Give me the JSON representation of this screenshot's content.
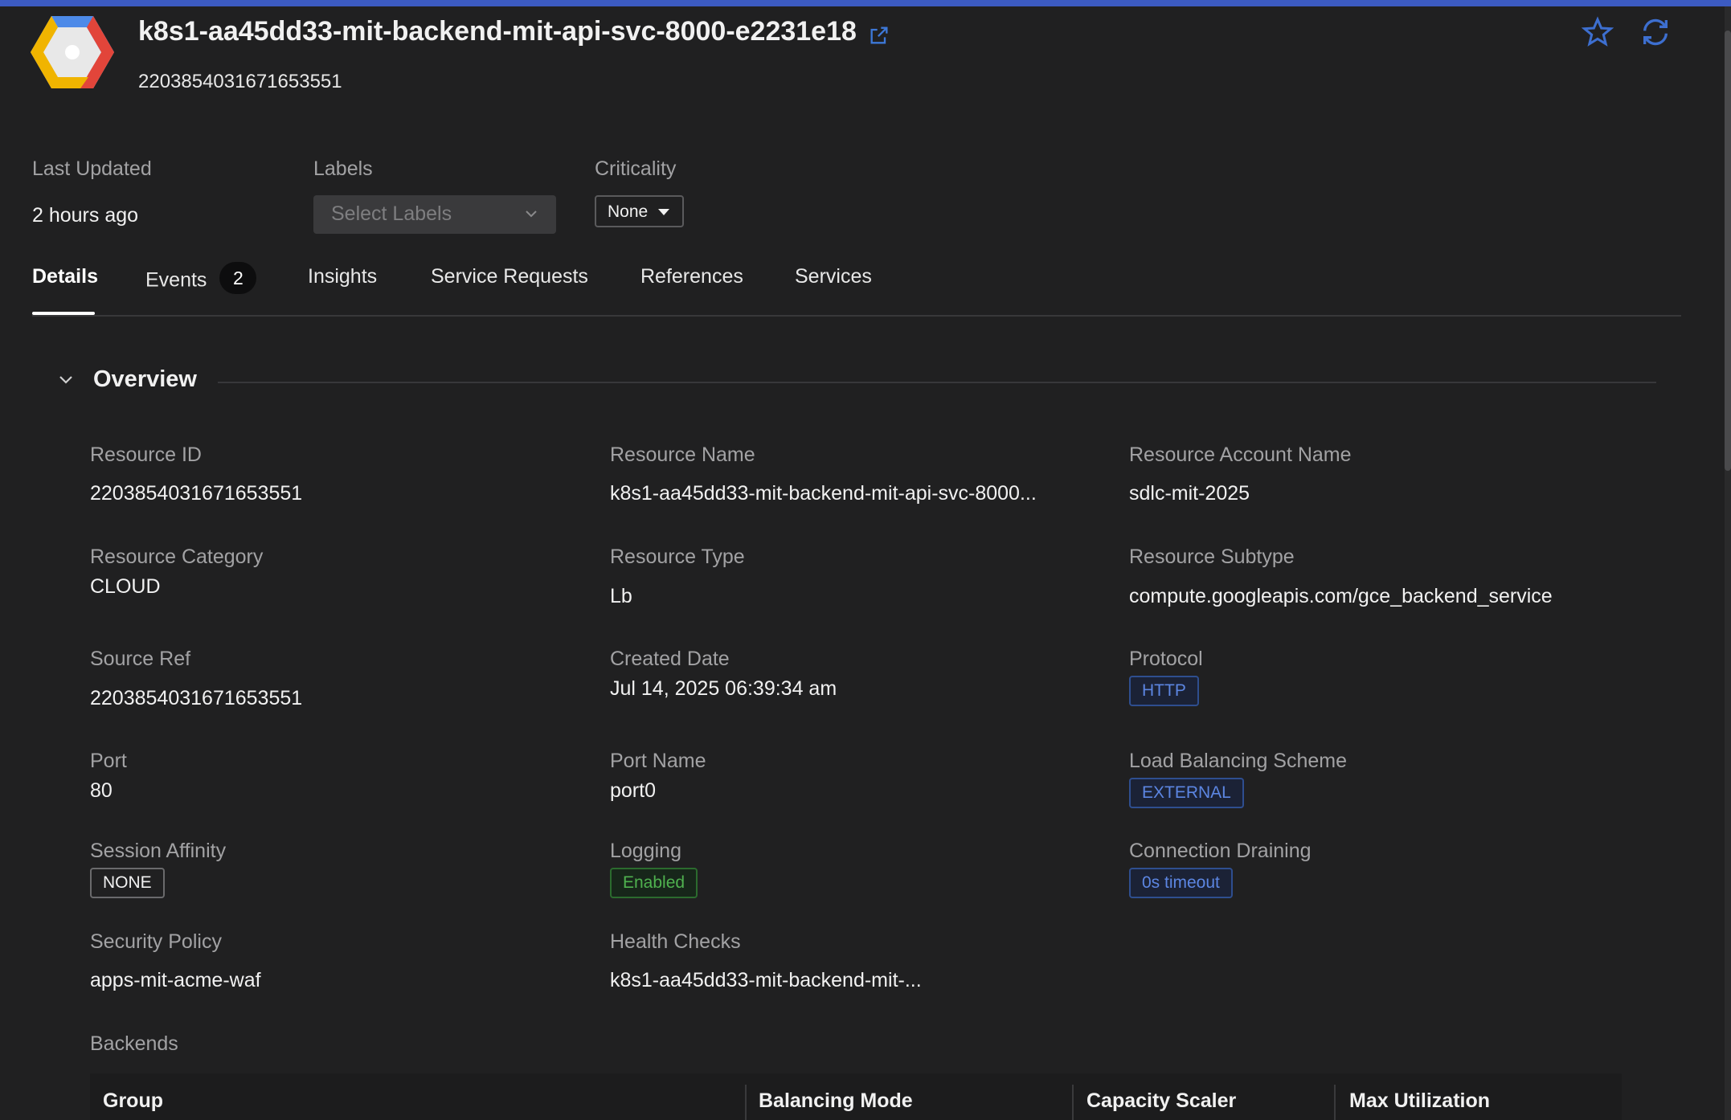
{
  "header": {
    "title": "k8s1-aa45dd33-mit-backend-mit-api-svc-8000-e2231e18",
    "subtitle": "2203854031671653551"
  },
  "meta": {
    "last_updated_label": "Last Updated",
    "last_updated_value": "2 hours ago",
    "labels_label": "Labels",
    "labels_placeholder": "Select Labels",
    "criticality_label": "Criticality",
    "criticality_value": "None"
  },
  "tabs": [
    {
      "label": "Details"
    },
    {
      "label": "Events",
      "count": "2"
    },
    {
      "label": "Insights"
    },
    {
      "label": "Service Requests"
    },
    {
      "label": "References"
    },
    {
      "label": "Services"
    }
  ],
  "section": {
    "title": "Overview"
  },
  "fields": {
    "resource_id": {
      "label": "Resource ID",
      "value": "2203854031671653551"
    },
    "resource_name": {
      "label": "Resource Name",
      "value": "k8s1-aa45dd33-mit-backend-mit-api-svc-8000..."
    },
    "resource_account_name": {
      "label": "Resource Account Name",
      "value": "sdlc-mit-2025"
    },
    "resource_category": {
      "label": "Resource Category",
      "value": "CLOUD"
    },
    "resource_type": {
      "label": "Resource Type",
      "value": "Lb"
    },
    "resource_subtype": {
      "label": "Resource Subtype",
      "value": "compute.googleapis.com/gce_backend_service"
    },
    "source_ref": {
      "label": "Source Ref",
      "value": "2203854031671653551"
    },
    "created_date": {
      "label": "Created Date",
      "value": "Jul 14, 2025 06:39:34 am"
    },
    "protocol": {
      "label": "Protocol",
      "value": "HTTP"
    },
    "port": {
      "label": "Port",
      "value": "80"
    },
    "port_name": {
      "label": "Port Name",
      "value": "port0"
    },
    "load_balancing_scheme": {
      "label": "Load Balancing Scheme",
      "value": "EXTERNAL"
    },
    "session_affinity": {
      "label": "Session Affinity",
      "value": "NONE"
    },
    "logging": {
      "label": "Logging",
      "value": "Enabled"
    },
    "connection_draining": {
      "label": "Connection Draining",
      "value": "0s timeout"
    },
    "security_policy": {
      "label": "Security Policy",
      "value": "apps-mit-acme-waf"
    },
    "health_checks": {
      "label": "Health Checks",
      "value": "k8s1-aa45dd33-mit-backend-mit-..."
    }
  },
  "backends": {
    "label": "Backends",
    "columns": [
      "Group",
      "Balancing Mode",
      "Capacity Scaler",
      "Max Utilization"
    ]
  },
  "colors": {
    "accent_bar": "#3c5bc2",
    "tag_blue": "#5c86e2",
    "tag_green": "#4fb14f"
  },
  "icons": [
    "gcp-logo-icon",
    "external-link-icon",
    "star-icon",
    "refresh-icon",
    "chevron-down-icon"
  ]
}
